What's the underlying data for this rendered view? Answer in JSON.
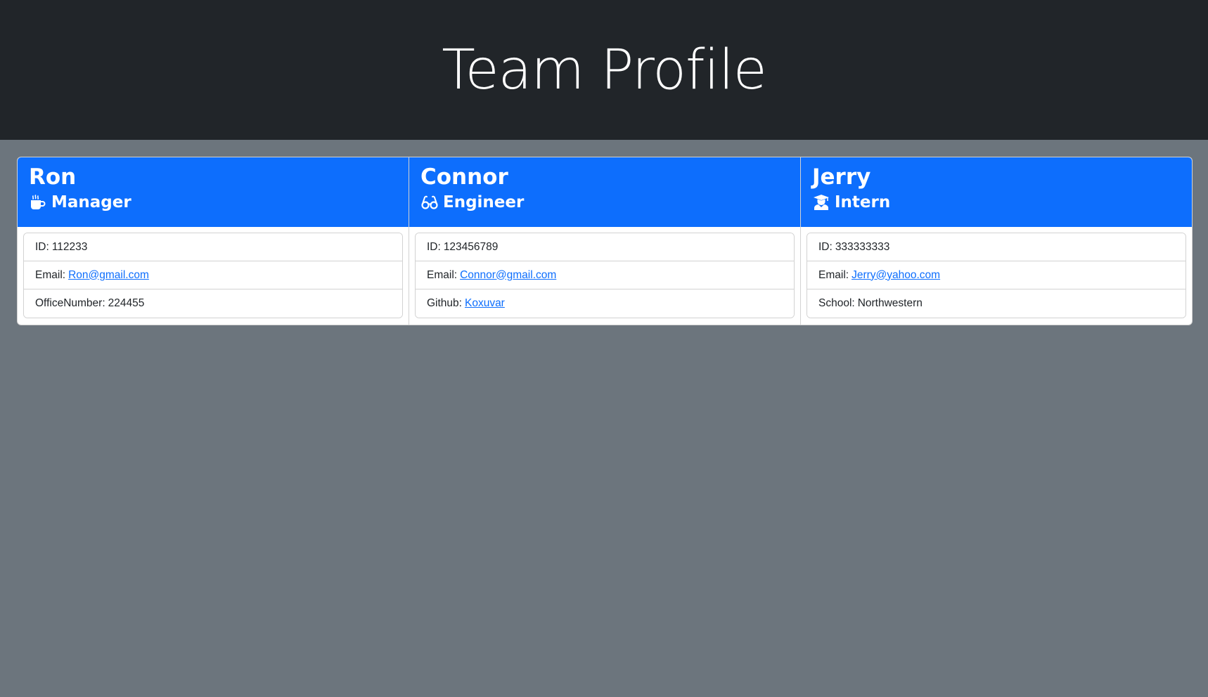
{
  "header": {
    "title": "Team Profile"
  },
  "colors": {
    "header_bg": "#212529",
    "page_bg": "#6c757d",
    "card_header_bg": "#0d6efd",
    "link": "#0d6efd"
  },
  "team": [
    {
      "name": "Ron",
      "role": "Manager",
      "role_icon": "mug-hot-icon",
      "id_label": "ID:",
      "id": "112233",
      "email_label": "Email:",
      "email": "Ron@gmail.com",
      "extra_label": "OfficeNumber:",
      "extra_value": "224455"
    },
    {
      "name": "Connor",
      "role": "Engineer",
      "role_icon": "glasses-icon",
      "id_label": "ID:",
      "id": "123456789",
      "email_label": "Email:",
      "email": "Connor@gmail.com",
      "extra_label": "Github:",
      "extra_value": "Koxuvar"
    },
    {
      "name": "Jerry",
      "role": "Intern",
      "role_icon": "user-graduate-icon",
      "id_label": "ID:",
      "id": "333333333",
      "email_label": "Email:",
      "email": "Jerry@yahoo.com",
      "extra_label": "School:",
      "extra_value": "Northwestern"
    }
  ]
}
